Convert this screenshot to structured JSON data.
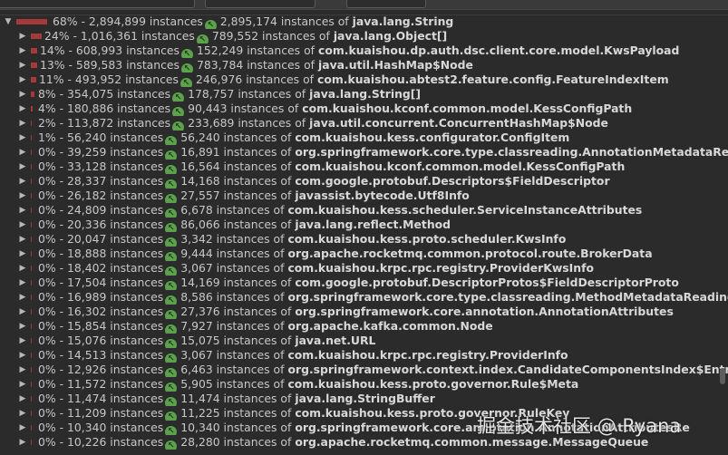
{
  "watermark": "掘金技术社区 @ Ryana",
  "icons": {
    "reference": "class-reference-icon",
    "expand": "chevron-right-icon",
    "collapse": "chevron-down-icon"
  },
  "colors": {
    "background": "#2b2b2b",
    "bar": "#a63a3a",
    "ref_icon": "#5ea14d"
  },
  "rows": [
    {
      "depth": 0,
      "expanded": true,
      "pct": 68,
      "label": "68% - 2,894,899 instances",
      "count": "2,895,174 instances of",
      "cls": "java.lang.String"
    },
    {
      "depth": 1,
      "expanded": false,
      "pct": 24,
      "label": "24% - 1,016,361 instances",
      "count": "789,552 instances of",
      "cls": "java.lang.Object[]"
    },
    {
      "depth": 1,
      "expanded": false,
      "pct": 14,
      "label": "14% - 608,993 instances",
      "count": "152,249 instances of",
      "cls": "com.kuaishou.dp.auth.dsc.client.core.model.KwsPayload"
    },
    {
      "depth": 1,
      "expanded": false,
      "pct": 13,
      "label": "13% - 589,583 instances",
      "count": "783,784 instances of",
      "cls": "java.util.HashMap$Node"
    },
    {
      "depth": 1,
      "expanded": false,
      "pct": 11,
      "label": "11% - 493,952 instances",
      "count": "246,976 instances of",
      "cls": "com.kuaishou.abtest2.feature.config.FeatureIndexItem"
    },
    {
      "depth": 1,
      "expanded": false,
      "pct": 8,
      "label": "8% - 354,075 instances",
      "count": "178,757 instances of",
      "cls": "java.lang.String[]"
    },
    {
      "depth": 1,
      "expanded": false,
      "pct": 4,
      "label": "4% - 180,886 instances",
      "count": "90,443 instances of",
      "cls": "com.kuaishou.kconf.common.model.KessConfigPath"
    },
    {
      "depth": 1,
      "expanded": false,
      "pct": 2,
      "label": "2% - 113,872 instances",
      "count": "233,689 instances of",
      "cls": "java.util.concurrent.ConcurrentHashMap$Node"
    },
    {
      "depth": 1,
      "expanded": false,
      "pct": 1,
      "label": "1% - 56,240 instances",
      "count": "56,240 instances of",
      "cls": "com.kuaishou.kess.configurator.ConfigItem"
    },
    {
      "depth": 1,
      "expanded": false,
      "pct": 0,
      "label": "0% - 39,259 instances",
      "count": "16,891 instances of",
      "cls": "org.springframework.core.type.classreading.AnnotationMetadataReading"
    },
    {
      "depth": 1,
      "expanded": false,
      "pct": 0,
      "label": "0% - 33,128 instances",
      "count": "16,564 instances of",
      "cls": "com.kuaishou.kconf.common.model.KessConfigPath"
    },
    {
      "depth": 1,
      "expanded": false,
      "pct": 0,
      "label": "0% - 28,337 instances",
      "count": "14,168 instances of",
      "cls": "com.google.protobuf.Descriptors$FieldDescriptor"
    },
    {
      "depth": 1,
      "expanded": false,
      "pct": 0,
      "label": "0% - 26,182 instances",
      "count": "27,557 instances of",
      "cls": "javassist.bytecode.Utf8Info"
    },
    {
      "depth": 1,
      "expanded": false,
      "pct": 0,
      "label": "0% - 24,809 instances",
      "count": "6,678 instances of",
      "cls": "com.kuaishou.kess.scheduler.ServiceInstanceAttributes"
    },
    {
      "depth": 1,
      "expanded": false,
      "pct": 0,
      "label": "0% - 20,336 instances",
      "count": "86,066 instances of",
      "cls": "java.lang.reflect.Method"
    },
    {
      "depth": 1,
      "expanded": false,
      "pct": 0,
      "label": "0% - 20,047 instances",
      "count": "3,342 instances of",
      "cls": "com.kuaishou.kess.proto.scheduler.KwsInfo"
    },
    {
      "depth": 1,
      "expanded": false,
      "pct": 0,
      "label": "0% - 18,888 instances",
      "count": "9,444 instances of",
      "cls": "org.apache.rocketmq.common.protocol.route.BrokerData"
    },
    {
      "depth": 1,
      "expanded": false,
      "pct": 0,
      "label": "0% - 18,402 instances",
      "count": "3,067 instances of",
      "cls": "com.kuaishou.krpc.rpc.registry.ProviderKwsInfo"
    },
    {
      "depth": 1,
      "expanded": false,
      "pct": 0,
      "label": "0% - 17,504 instances",
      "count": "14,169 instances of",
      "cls": "com.google.protobuf.DescriptorProtos$FieldDescriptorProto"
    },
    {
      "depth": 1,
      "expanded": false,
      "pct": 0,
      "label": "0% - 16,989 instances",
      "count": "8,586 instances of",
      "cls": "org.springframework.core.type.classreading.MethodMetadataReadingVis"
    },
    {
      "depth": 1,
      "expanded": false,
      "pct": 0,
      "label": "0% - 16,302 instances",
      "count": "27,376 instances of",
      "cls": "org.springframework.core.annotation.AnnotationAttributes"
    },
    {
      "depth": 1,
      "expanded": false,
      "pct": 0,
      "label": "0% - 15,854 instances",
      "count": "7,927 instances of",
      "cls": "org.apache.kafka.common.Node"
    },
    {
      "depth": 1,
      "expanded": false,
      "pct": 0,
      "label": "0% - 15,076 instances",
      "count": "15,075 instances of",
      "cls": "java.net.URL"
    },
    {
      "depth": 1,
      "expanded": false,
      "pct": 0,
      "label": "0% - 14,513 instances",
      "count": "3,067 instances of",
      "cls": "com.kuaishou.krpc.rpc.registry.ProviderInfo"
    },
    {
      "depth": 1,
      "expanded": false,
      "pct": 0,
      "label": "0% - 12,926 instances",
      "count": "6,463 instances of",
      "cls": "org.springframework.context.index.CandidateComponentsIndex$Entry"
    },
    {
      "depth": 1,
      "expanded": false,
      "pct": 0,
      "label": "0% - 11,572 instances",
      "count": "5,905 instances of",
      "cls": "com.kuaishou.kess.proto.governor.Rule$Meta"
    },
    {
      "depth": 1,
      "expanded": false,
      "pct": 0,
      "label": "0% - 11,474 instances",
      "count": "11,474 instances of",
      "cls": "java.lang.StringBuffer"
    },
    {
      "depth": 1,
      "expanded": false,
      "pct": 0,
      "label": "0% - 11,209 instances",
      "count": "11,225 instances of",
      "cls": "com.kuaishou.kess.proto.governor.RuleKey"
    },
    {
      "depth": 1,
      "expanded": false,
      "pct": 0,
      "label": "0% - 10,340 instances",
      "count": "10,340 instances of",
      "cls": "org.springframework.core.annotation.AnnotationAttributesRe"
    },
    {
      "depth": 1,
      "expanded": false,
      "pct": 0,
      "label": "0% - 10,226 instances",
      "count": "28,280 instances of",
      "cls": "org.apache.rocketmq.common.message.MessageQueue"
    }
  ]
}
